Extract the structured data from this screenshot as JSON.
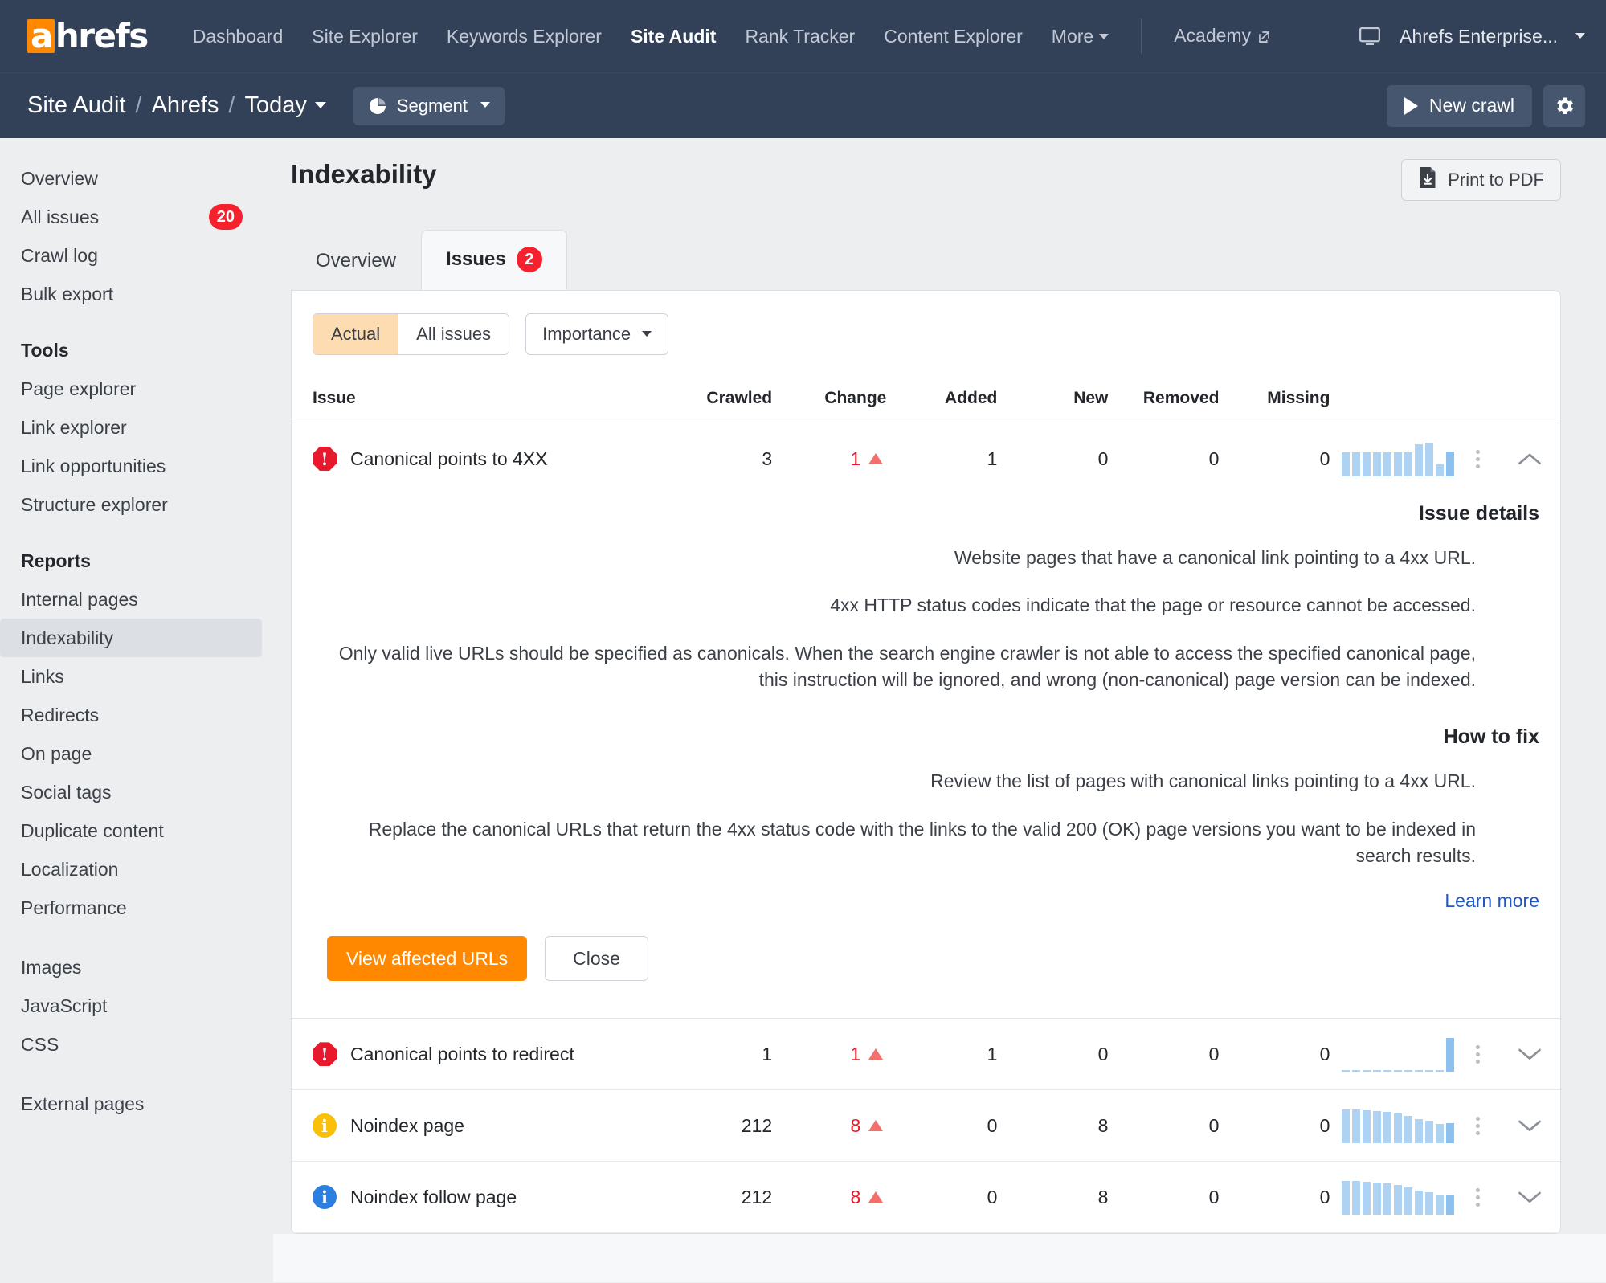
{
  "topnav": {
    "logo": {
      "accent_letter": "a",
      "rest": "hrefs",
      "accent_color": "#ff8800"
    },
    "links": [
      {
        "label": "Dashboard",
        "active": false
      },
      {
        "label": "Site Explorer",
        "active": false
      },
      {
        "label": "Keywords Explorer",
        "active": false
      },
      {
        "label": "Site Audit",
        "active": true
      },
      {
        "label": "Rank Tracker",
        "active": false
      },
      {
        "label": "Content Explorer",
        "active": false
      },
      {
        "label": "More",
        "active": false,
        "caret": true
      }
    ],
    "academy": "Academy",
    "account": "Ahrefs Enterprise..."
  },
  "subnav": {
    "crumb1": "Site Audit",
    "sep1": "/",
    "crumb2": "Ahrefs",
    "sep2": "/",
    "crumb3": "Today",
    "segment_label": "Segment",
    "new_crawl_label": "New crawl"
  },
  "sidebar": {
    "items": [
      {
        "label": "Overview",
        "badge": null,
        "selected": false
      },
      {
        "label": "All issues",
        "badge": "20",
        "selected": false
      },
      {
        "label": "Crawl log",
        "badge": null,
        "selected": false
      },
      {
        "label": "Bulk export",
        "badge": null,
        "selected": false
      }
    ],
    "tools_heading": "Tools",
    "tools": [
      {
        "label": "Page explorer"
      },
      {
        "label": "Link explorer"
      },
      {
        "label": "Link opportunities"
      },
      {
        "label": "Structure explorer"
      }
    ],
    "reports_heading": "Reports",
    "reports": [
      {
        "label": "Internal pages",
        "selected": false
      },
      {
        "label": "Indexability",
        "selected": true
      },
      {
        "label": "Links",
        "selected": false
      },
      {
        "label": "Redirects",
        "selected": false
      },
      {
        "label": "On page",
        "selected": false
      },
      {
        "label": "Social tags",
        "selected": false
      },
      {
        "label": "Duplicate content",
        "selected": false
      },
      {
        "label": "Localization",
        "selected": false
      },
      {
        "label": "Performance",
        "selected": false
      }
    ],
    "resources": [
      {
        "label": "Images"
      },
      {
        "label": "JavaScript"
      },
      {
        "label": "CSS"
      }
    ],
    "external": [
      {
        "label": "External pages"
      }
    ]
  },
  "main": {
    "page_title": "Indexability",
    "print_pdf_label": "Print to PDF",
    "tabs": [
      {
        "label": "Overview",
        "badge": null,
        "active": false
      },
      {
        "label": "Issues",
        "badge": "2",
        "active": true
      }
    ],
    "filters": {
      "actual": "Actual",
      "all_issues": "All issues",
      "importance": "Importance"
    },
    "columns": [
      "Issue",
      "Crawled",
      "Change",
      "Added",
      "New",
      "Removed",
      "Missing"
    ],
    "rows": [
      {
        "severity": "error",
        "severity_glyph": "!",
        "issue": "Canonical points to 4XX",
        "crawled": "3",
        "change": "1",
        "change_dir": "up",
        "added": "1",
        "new": "0",
        "removed": "0",
        "missing": "0",
        "expanded": true,
        "spark": [
          62,
          62,
          62,
          62,
          62,
          62,
          62,
          82,
          86,
          30,
          64
        ]
      },
      {
        "severity": "error",
        "severity_glyph": "!",
        "issue": "Canonical points to redirect",
        "crawled": "1",
        "change": "1",
        "change_dir": "up",
        "added": "1",
        "new": "0",
        "removed": "0",
        "missing": "0",
        "expanded": false,
        "spark": [
          3,
          3,
          3,
          3,
          3,
          3,
          3,
          3,
          3,
          3,
          100
        ]
      },
      {
        "severity": "warning",
        "severity_glyph": "i",
        "issue": "Noindex page",
        "crawled": "212",
        "change": "8",
        "change_dir": "up",
        "added": "0",
        "new": "8",
        "removed": "0",
        "missing": "0",
        "expanded": false,
        "spark": [
          100,
          100,
          98,
          96,
          92,
          88,
          80,
          72,
          66,
          58,
          60
        ]
      },
      {
        "severity": "notice",
        "severity_glyph": "i",
        "issue": "Noindex follow page",
        "crawled": "212",
        "change": "8",
        "change_dir": "up",
        "added": "0",
        "new": "8",
        "removed": "0",
        "missing": "0",
        "expanded": false,
        "spark": [
          100,
          100,
          98,
          96,
          92,
          88,
          80,
          72,
          66,
          58,
          60
        ]
      }
    ],
    "detail": {
      "issue_details_heading": "Issue details",
      "p1": "Website pages that have a canonical link pointing to a 4xx URL.",
      "p2": "4xx HTTP status codes indicate that the page or resource cannot be accessed.",
      "p3": "Only valid live URLs should be specified as canonicals. When the search engine crawler is not able to access the specified canonical page, this instruction will be ignored, and wrong (non-canonical) page version can be indexed.",
      "how_to_fix_heading": "How to fix",
      "p4": "Review the list of pages with canonical links pointing to a 4xx URL.",
      "p5": "Replace the canonical URLs that return the 4xx status code with the links to the valid 200 (OK) page versions you want to be indexed in search results.",
      "learn_more": "Learn more",
      "view_affected": "View affected URLs",
      "close": "Close"
    }
  },
  "colors": {
    "navy": "#324158",
    "orange": "#ff8800",
    "red": "#f5222d",
    "warning": "#fac008",
    "notice": "#2a7fe0",
    "link": "#2156c7",
    "spark": "#aed2f2"
  }
}
